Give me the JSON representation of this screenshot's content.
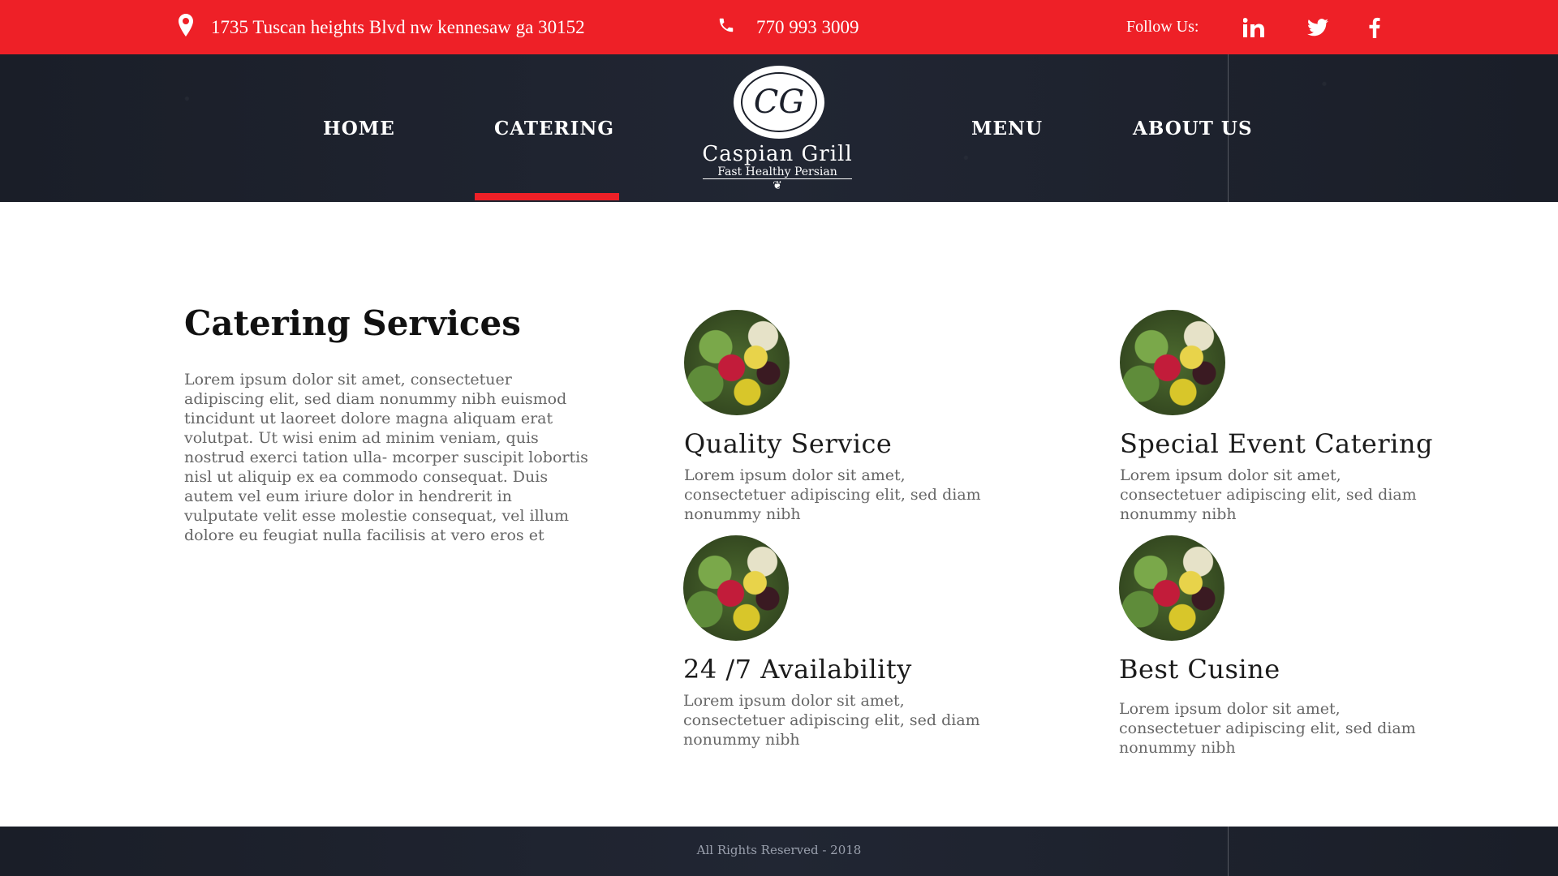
{
  "topbar": {
    "address": "1735 Tuscan heights Blvd nw kennesaw ga 30152",
    "phone": "770 993 3009",
    "follow_label": "Follow Us:",
    "social": [
      {
        "icon": "linkedin-icon",
        "glyph": "in"
      },
      {
        "icon": "twitter-icon",
        "glyph": "🐦"
      },
      {
        "icon": "facebook-icon",
        "glyph": "f"
      }
    ]
  },
  "nav": {
    "items": [
      {
        "label": "HOME",
        "active": false
      },
      {
        "label": "CATERING",
        "active": true
      },
      {
        "label": "MENU",
        "active": false
      },
      {
        "label": "ABOUT US",
        "active": false
      }
    ],
    "logo": {
      "monogram": "CG",
      "name": "Caspian Grill",
      "tagline": "Fast Healthy Persian"
    }
  },
  "content": {
    "heading": "Catering Services",
    "intro": "Lorem ipsum dolor sit amet, consectetuer adipiscing elit, sed diam nonummy nibh euismod tincidunt ut laoreet dolore magna aliquam erat volutpat. Ut wisi enim ad minim veniam, quis nostrud exerci tation ulla- mcorper suscipit lobortis nisl ut aliquip ex ea commodo consequat. Duis autem vel eum iriure dolor in hendrerit in vulputate velit esse molestie consequat, vel illum dolore eu feugiat nulla facilisis at vero eros et",
    "features": [
      {
        "title": "Quality Service",
        "desc": "Lorem ipsum dolor sit amet, consectetuer adipiscing elit, sed diam nonummy nibh"
      },
      {
        "title": "Special Event Catering",
        "desc": "Lorem ipsum dolor sit amet, consectetuer adipiscing elit, sed diam nonummy nibh"
      },
      {
        "title": "24 /7 Availability",
        "desc": "Lorem ipsum dolor sit amet, consectetuer adipiscing elit, sed diam nonummy nibh"
      },
      {
        "title": "Best Cusine",
        "desc": "Lorem ipsum dolor sit amet, consectetuer adipiscing elit, sed diam nonummy nibh"
      }
    ]
  },
  "footer": {
    "copyright": "All Rights Reserved - 2018"
  },
  "colors": {
    "accent": "#ee2027",
    "dark": "#1b1f2a"
  }
}
